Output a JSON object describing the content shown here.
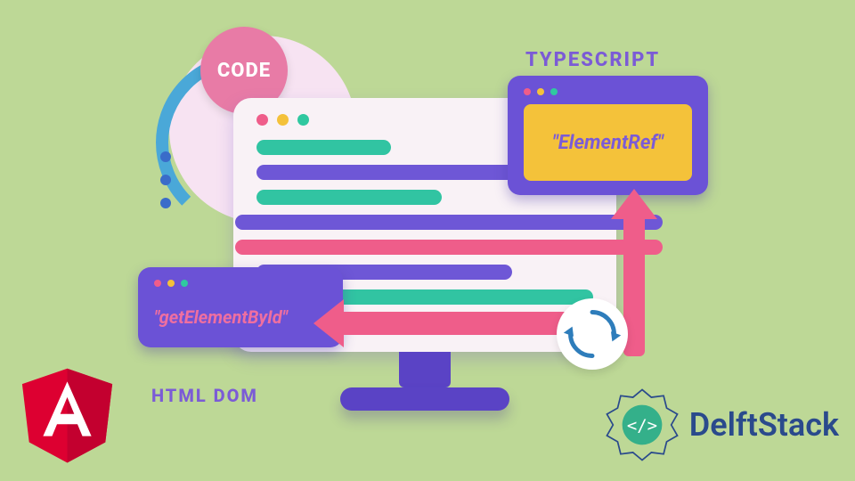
{
  "badge": {
    "code": "CODE"
  },
  "labels": {
    "typescript": "TYPESCRIPT",
    "html_dom": "HTML DOM"
  },
  "windows": {
    "typescript_content": "\"ElementRef\"",
    "dom_content": "\"getElementById\""
  },
  "brand": {
    "delftstack": "DelftStack"
  },
  "colors": {
    "bg": "#bdd896",
    "purple": "#6b52d6",
    "pink": "#ef5d8a",
    "teal": "#31c4a2",
    "yellow": "#f4c23a",
    "blue": "#2a4a8c",
    "angular_red": "#dd0031"
  }
}
